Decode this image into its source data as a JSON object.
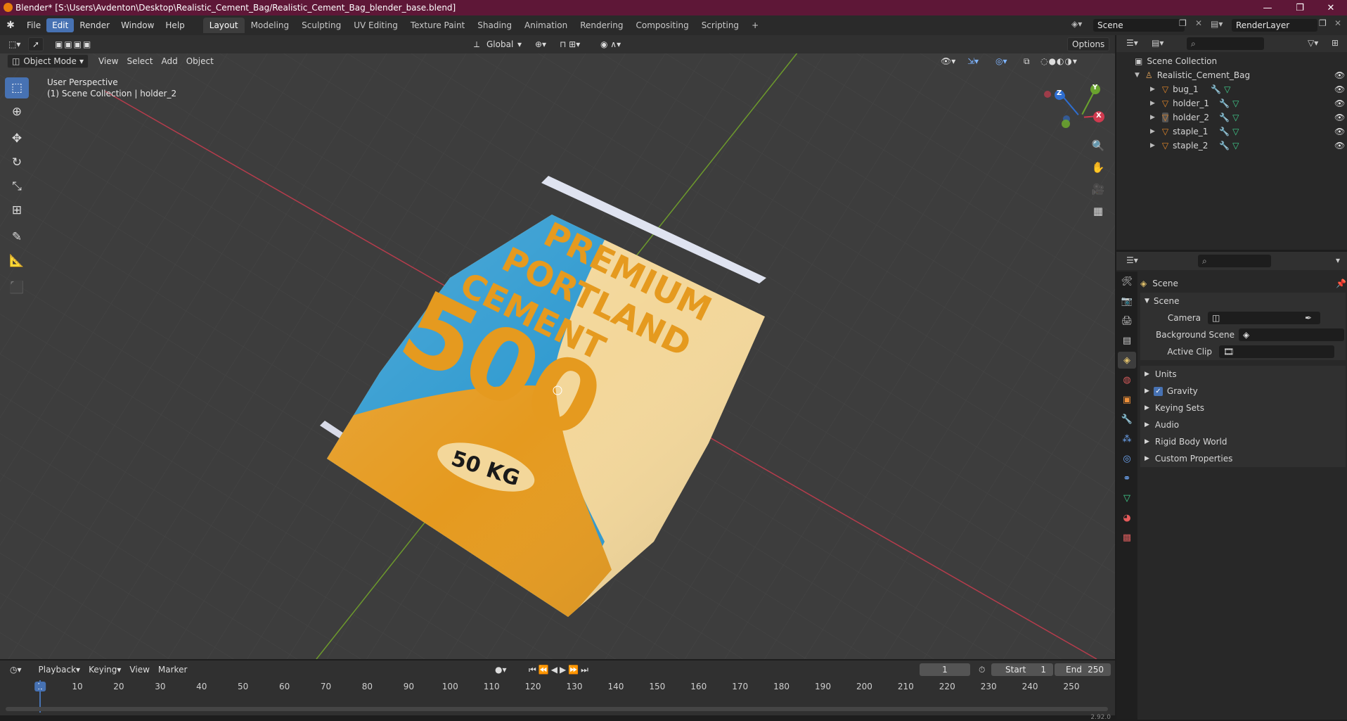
{
  "window": {
    "title": "Blender* [S:\\Users\\Avdenton\\Desktop\\Realistic_Cement_Bag/Realistic_Cement_Bag_blender_base.blend]",
    "controls": [
      "—",
      "❐",
      "✕"
    ]
  },
  "menubar": {
    "menus": [
      "File",
      "Edit",
      "Render",
      "Window",
      "Help"
    ],
    "active_menu": "Edit",
    "workspaces": [
      "Layout",
      "Modeling",
      "Sculpting",
      "UV Editing",
      "Texture Paint",
      "Shading",
      "Animation",
      "Rendering",
      "Compositing",
      "Scripting"
    ],
    "active_workspace": "Layout",
    "add_tab": "+",
    "scene_name": "Scene",
    "view_layer": "RenderLayer"
  },
  "viewport": {
    "mode": "Object Mode",
    "menus": [
      "View",
      "Select",
      "Add",
      "Object"
    ],
    "transform_orientation": "Global",
    "options_label": "Options",
    "overlay_line1": "User Perspective",
    "overlay_line2": "(1) Scene Collection | holder_2",
    "gizmo_axes": {
      "x": "X",
      "y": "Y",
      "z": "Z"
    },
    "tools": [
      "select-box",
      "cursor",
      "move",
      "rotate",
      "scale",
      "transform",
      "annotate",
      "measure",
      "add-cube"
    ],
    "bag": {
      "line1": "PREMIUM",
      "line2": "PORTLAND",
      "line3": "CEMENT",
      "big_number": "500",
      "weight": "50 KG",
      "colors": {
        "blue": "#2f9ad0",
        "orange": "#e59a1f",
        "cream": "#f3d79a",
        "ink": "#1a1a1a"
      }
    }
  },
  "outliner": {
    "root": "Scene Collection",
    "collection": "Realistic_Cement_Bag",
    "objects": [
      "bug_1",
      "holder_1",
      "holder_2",
      "staple_1",
      "staple_2"
    ]
  },
  "properties": {
    "context_title": "Scene",
    "panel_title": "Scene",
    "fields": [
      {
        "label": "Camera",
        "value": ""
      },
      {
        "label": "Background Scene",
        "value": ""
      },
      {
        "label": "Active Clip",
        "value": ""
      }
    ],
    "subpanels": [
      "Units",
      "Gravity",
      "Keying Sets",
      "Audio",
      "Rigid Body World",
      "Custom Properties"
    ],
    "gravity_checked": true
  },
  "timeline": {
    "menus": [
      "Playback",
      "Keying",
      "View",
      "Marker"
    ],
    "current_frame": "1",
    "start_label": "Start",
    "start_value": "1",
    "end_label": "End",
    "end_value": "250",
    "ticks": [
      "1",
      "10",
      "20",
      "30",
      "40",
      "50",
      "60",
      "70",
      "80",
      "90",
      "100",
      "110",
      "120",
      "130",
      "140",
      "150",
      "160",
      "170",
      "180",
      "190",
      "200",
      "210",
      "220",
      "230",
      "240",
      "250"
    ]
  },
  "statusbar": {
    "version": "2.92.0"
  },
  "accent": "#4772b3"
}
